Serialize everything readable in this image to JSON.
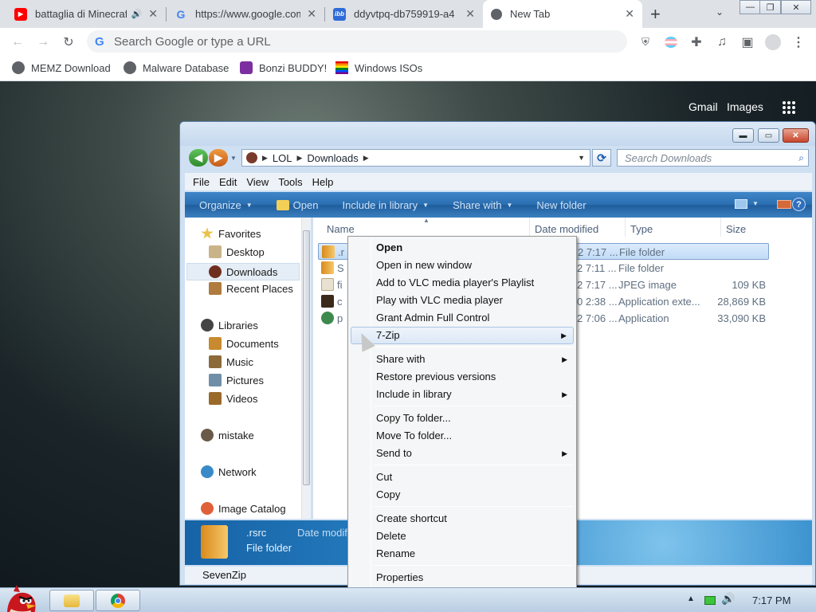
{
  "browser": {
    "tabs": [
      {
        "title": "battaglia di Minecraft",
        "icon": "youtube-icon",
        "audio": true
      },
      {
        "title": "https://www.google.com/",
        "icon": "google-icon"
      },
      {
        "title": "ddyvtpq-db759919-a4",
        "icon": "ibb-icon"
      },
      {
        "title": "New Tab",
        "icon": "chrome-icon",
        "active": true
      }
    ],
    "new_tab_symbol": "+",
    "omnibox_placeholder": "Search Google or type a URL",
    "bookmarks": [
      {
        "label": "MEMZ Download"
      },
      {
        "label": "Malware Database"
      },
      {
        "label": "Bonzi BUDDY!"
      },
      {
        "label": "Windows ISOs"
      }
    ]
  },
  "ntp": {
    "gmail": "Gmail",
    "images": "Images"
  },
  "explorer": {
    "breadcrumb": [
      "LOL",
      "Downloads"
    ],
    "search_placeholder": "Search Downloads",
    "menu": [
      "File",
      "Edit",
      "View",
      "Tools",
      "Help"
    ],
    "commands": {
      "organize": "Organize",
      "open": "Open",
      "include_in_library": "Include in library",
      "share_with": "Share with",
      "new_folder": "New folder"
    },
    "nav": {
      "favorites": "Favorites",
      "desktop": "Desktop",
      "downloads": "Downloads",
      "recent_places": "Recent Places",
      "libraries": "Libraries",
      "documents": "Documents",
      "music": "Music",
      "pictures": "Pictures",
      "videos": "Videos",
      "mistake": "mistake",
      "network": "Network",
      "image_catalog": "Image Catalog"
    },
    "columns": {
      "name": "Name",
      "date_modified": "Date modified",
      "type": "Type",
      "size": "Size"
    },
    "files": [
      {
        "name": ".r",
        "date": "2 7:17 ...",
        "type": "File folder",
        "size": ""
      },
      {
        "name": "S",
        "date": "2 7:11 ...",
        "type": "File folder",
        "size": ""
      },
      {
        "name": "fi",
        "date": "2 7:17 ...",
        "type": "JPEG image",
        "size": "109 KB"
      },
      {
        "name": "c",
        "date": "0 2:38 ...",
        "type": "Application exte...",
        "size": "28,869 KB"
      },
      {
        "name": "p",
        "date": "2 7:06 ...",
        "type": "Application",
        "size": "33,090 KB"
      }
    ],
    "details": {
      "name": ".rsrc",
      "type": "File folder",
      "date_label": "Date modifi"
    },
    "status": "SevenZip"
  },
  "context_menu": {
    "items": [
      {
        "label": "Open",
        "bold": true
      },
      {
        "label": "Open in new window"
      },
      {
        "label": "Add to VLC media player's Playlist"
      },
      {
        "label": "Play with VLC media player"
      },
      {
        "label": "Grant Admin Full Control"
      },
      {
        "label": "7-Zip",
        "submenu": true,
        "hover": true
      },
      {
        "label": "Share with",
        "submenu": true
      },
      {
        "label": "Restore previous versions"
      },
      {
        "label": "Include in library",
        "submenu": true
      },
      {
        "label": "Copy To folder..."
      },
      {
        "label": "Move To folder..."
      },
      {
        "label": "Send to",
        "submenu": true
      },
      {
        "label": "Cut"
      },
      {
        "label": "Copy"
      },
      {
        "label": "Create shortcut"
      },
      {
        "label": "Delete"
      },
      {
        "label": "Rename"
      },
      {
        "label": "Properties"
      }
    ]
  },
  "taskbar": {
    "clock": "7:17 PM"
  }
}
